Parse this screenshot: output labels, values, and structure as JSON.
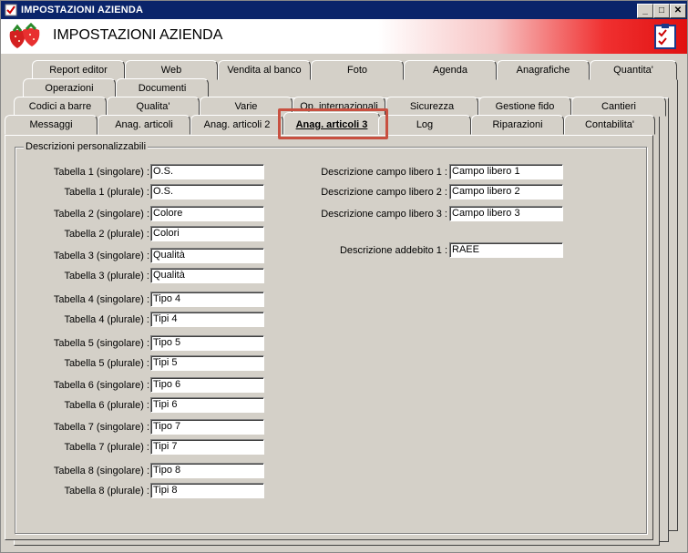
{
  "window": {
    "title": "IMPOSTAZIONI AZIENDA",
    "header_title": "IMPOSTAZIONI AZIENDA",
    "controls": {
      "minimize": "_",
      "maximize": "□",
      "close": "✕"
    }
  },
  "tabs": {
    "row1": [
      "Report editor",
      "Web",
      "Vendita al banco",
      "Foto",
      "Agenda",
      "Anagrafiche",
      "Quantita'"
    ],
    "row2": [
      "Operazioni",
      "Documenti"
    ],
    "row3": [
      "Codici a barre",
      "Qualita'",
      "Varie",
      "Op. internazionali",
      "Sicurezza",
      "Gestione fido",
      "Cantieri"
    ],
    "row4": [
      "Messaggi",
      "Anag. articoli",
      "Anag. articoli 2",
      "Anag. articoli 3",
      "Log",
      "Riparazioni",
      "Contabilita'"
    ],
    "active": "Anag. articoli 3"
  },
  "group": {
    "title": "Descrizioni personalizzabili"
  },
  "tables": [
    {
      "label": "Tabella 1 (singolare) :",
      "value": "O.S."
    },
    {
      "label": "Tabella 1 (plurale) :",
      "value": "O.S."
    },
    {
      "label": "Tabella 2 (singolare) :",
      "value": "Colore"
    },
    {
      "label": "Tabella 2 (plurale) :",
      "value": "Colori"
    },
    {
      "label": "Tabella 3 (singolare) :",
      "value": "Qualità"
    },
    {
      "label": "Tabella 3 (plurale) :",
      "value": "Qualità"
    },
    {
      "label": "Tabella 4 (singolare) :",
      "value": "Tipo 4"
    },
    {
      "label": "Tabella 4 (plurale) :",
      "value": "Tipi 4"
    },
    {
      "label": "Tabella 5 (singolare) :",
      "value": "Tipo 5"
    },
    {
      "label": "Tabella 5 (plurale) :",
      "value": "Tipi 5"
    },
    {
      "label": "Tabella 6 (singolare) :",
      "value": "Tipo 6"
    },
    {
      "label": "Tabella 6 (plurale) :",
      "value": "Tipi 6"
    },
    {
      "label": "Tabella 7 (singolare) :",
      "value": "Tipo 7"
    },
    {
      "label": "Tabella 7 (plurale) :",
      "value": "Tipi 7"
    },
    {
      "label": "Tabella 8 (singolare) :",
      "value": "Tipo 8"
    },
    {
      "label": "Tabella 8 (plurale) :",
      "value": "Tipi 8"
    }
  ],
  "free_fields": [
    {
      "label": "Descrizione campo libero 1 :",
      "value": "Campo libero 1"
    },
    {
      "label": "Descrizione campo libero 2 :",
      "value": "Campo libero 2"
    },
    {
      "label": "Descrizione campo libero 3 :",
      "value": "Campo libero 3"
    }
  ],
  "charge": {
    "label": "Descrizione addebito 1 :",
    "value": "RAEE"
  },
  "colors": {
    "titlebar": "#0a246a",
    "highlight": "#c85040",
    "header_gradient_end": "#e01010"
  }
}
